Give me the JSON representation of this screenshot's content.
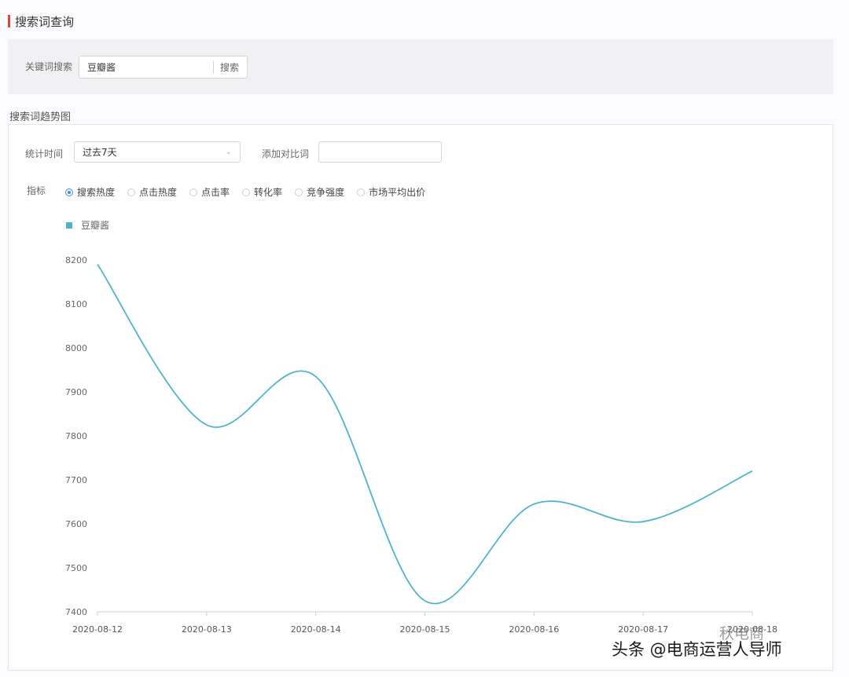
{
  "header": {
    "title": "搜索词查询"
  },
  "search": {
    "label": "关键词搜索",
    "value": "豆瓣酱",
    "button": "搜索"
  },
  "trend": {
    "title": "搜索词趋势图",
    "period_label": "统计时间",
    "period_value": "过去7天",
    "compare_label": "添加对比词",
    "metrics_label": "指标",
    "metrics": [
      {
        "label": "搜索热度",
        "selected": true
      },
      {
        "label": "点击热度",
        "selected": false
      },
      {
        "label": "点击率",
        "selected": false
      },
      {
        "label": "转化率",
        "selected": false
      },
      {
        "label": "竞争强度",
        "selected": false
      },
      {
        "label": "市场平均出价",
        "selected": false
      }
    ]
  },
  "chart_data": {
    "type": "line",
    "categories": [
      "2020-08-12",
      "2020-08-13",
      "2020-08-14",
      "2020-08-15",
      "2020-08-16",
      "2020-08-17",
      "2020-08-18"
    ],
    "series": [
      {
        "name": "豆瓣酱",
        "color": "#4fb3d0",
        "values": [
          8190,
          7825,
          7935,
          7425,
          7645,
          7605,
          7720
        ]
      }
    ],
    "yticks": [
      7400,
      7500,
      7600,
      7700,
      7800,
      7900,
      8000,
      8100,
      8200
    ],
    "ylim": [
      7400,
      8200
    ],
    "legend_position": "top-left",
    "grid": false
  },
  "watermark": {
    "text": "头条 @电商运营人导师",
    "logo_text": "秋电商"
  }
}
